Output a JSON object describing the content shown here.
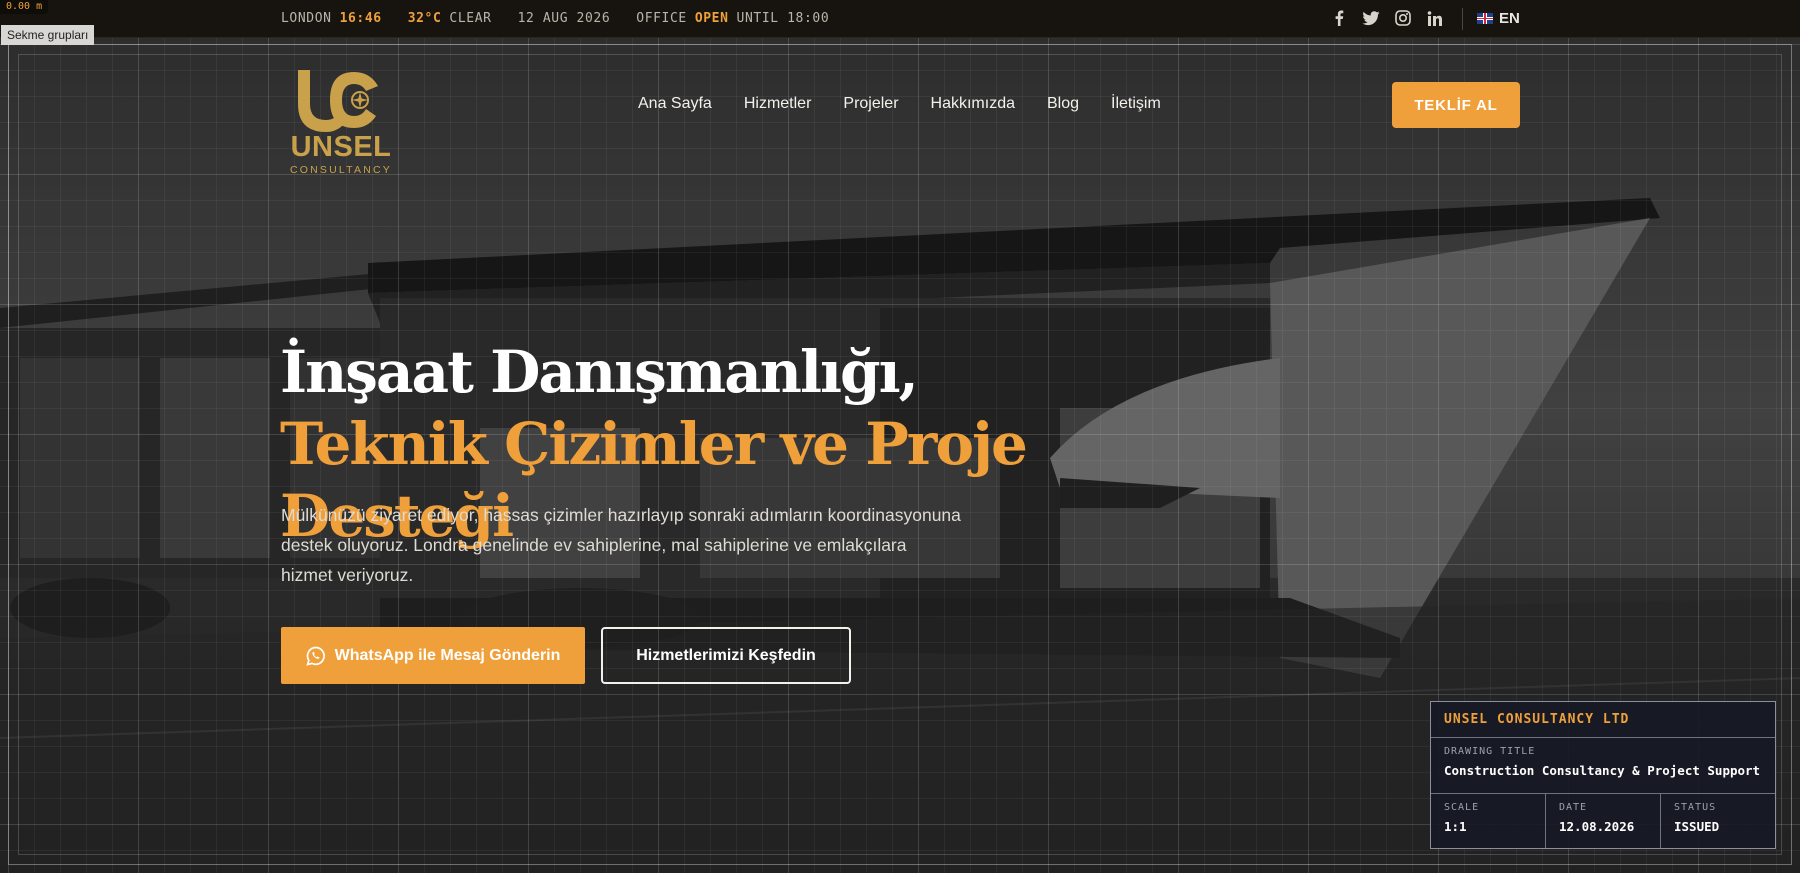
{
  "overlay": {
    "meter": "0.00 m",
    "tab_groups": "Sekme grupları"
  },
  "topbar": {
    "city": "LONDON",
    "time": "16:46",
    "temperature": "32°C",
    "weather": "CLEAR",
    "date": "12 AUG 2026",
    "office_label": "OFFICE",
    "office_status": "OPEN",
    "office_until": "UNTIL 18:00",
    "social": [
      "facebook-icon",
      "twitter-icon",
      "instagram-icon",
      "linkedin-icon"
    ],
    "language": "EN"
  },
  "brand": {
    "name": "UNSEL",
    "tagline": "CONSULTANCY",
    "color": "#c9a14a"
  },
  "nav": {
    "items": [
      "Ana Sayfa",
      "Hizmetler",
      "Projeler",
      "Hakkımızda",
      "Blog",
      "İletişim"
    ],
    "cta": "TEKLİF AL"
  },
  "hero": {
    "title_white": "İnşaat Danışmanlığı,",
    "title_accent": "Teknik Çizimler ve Proje Desteği",
    "lead": "Mülkünüzü ziyaret ediyor, hassas çizimler hazırlayıp sonraki adımların koordinasyonuna destek oluyoruz. Londra genelinde ev sahiplerine, mal sahiplerine ve emlakçılara hizmet veriyoruz.",
    "primary_button": "WhatsApp ile Mesaj Gönderin",
    "secondary_button": "Hizmetlerimizi Keşfedin"
  },
  "title_block": {
    "company": "UNSEL CONSULTANCY LTD",
    "drawing_title_label": "DRAWING TITLE",
    "drawing_title": "Construction Consultancy & Project Support",
    "scale_label": "SCALE",
    "scale": "1:1",
    "date_label": "DATE",
    "date": "12.08.2026",
    "status_label": "STATUS",
    "status": "ISSUED"
  },
  "colors": {
    "accent": "#f0a03a",
    "topbar_bg": "#17140f",
    "panel_bg": "#161a26"
  }
}
